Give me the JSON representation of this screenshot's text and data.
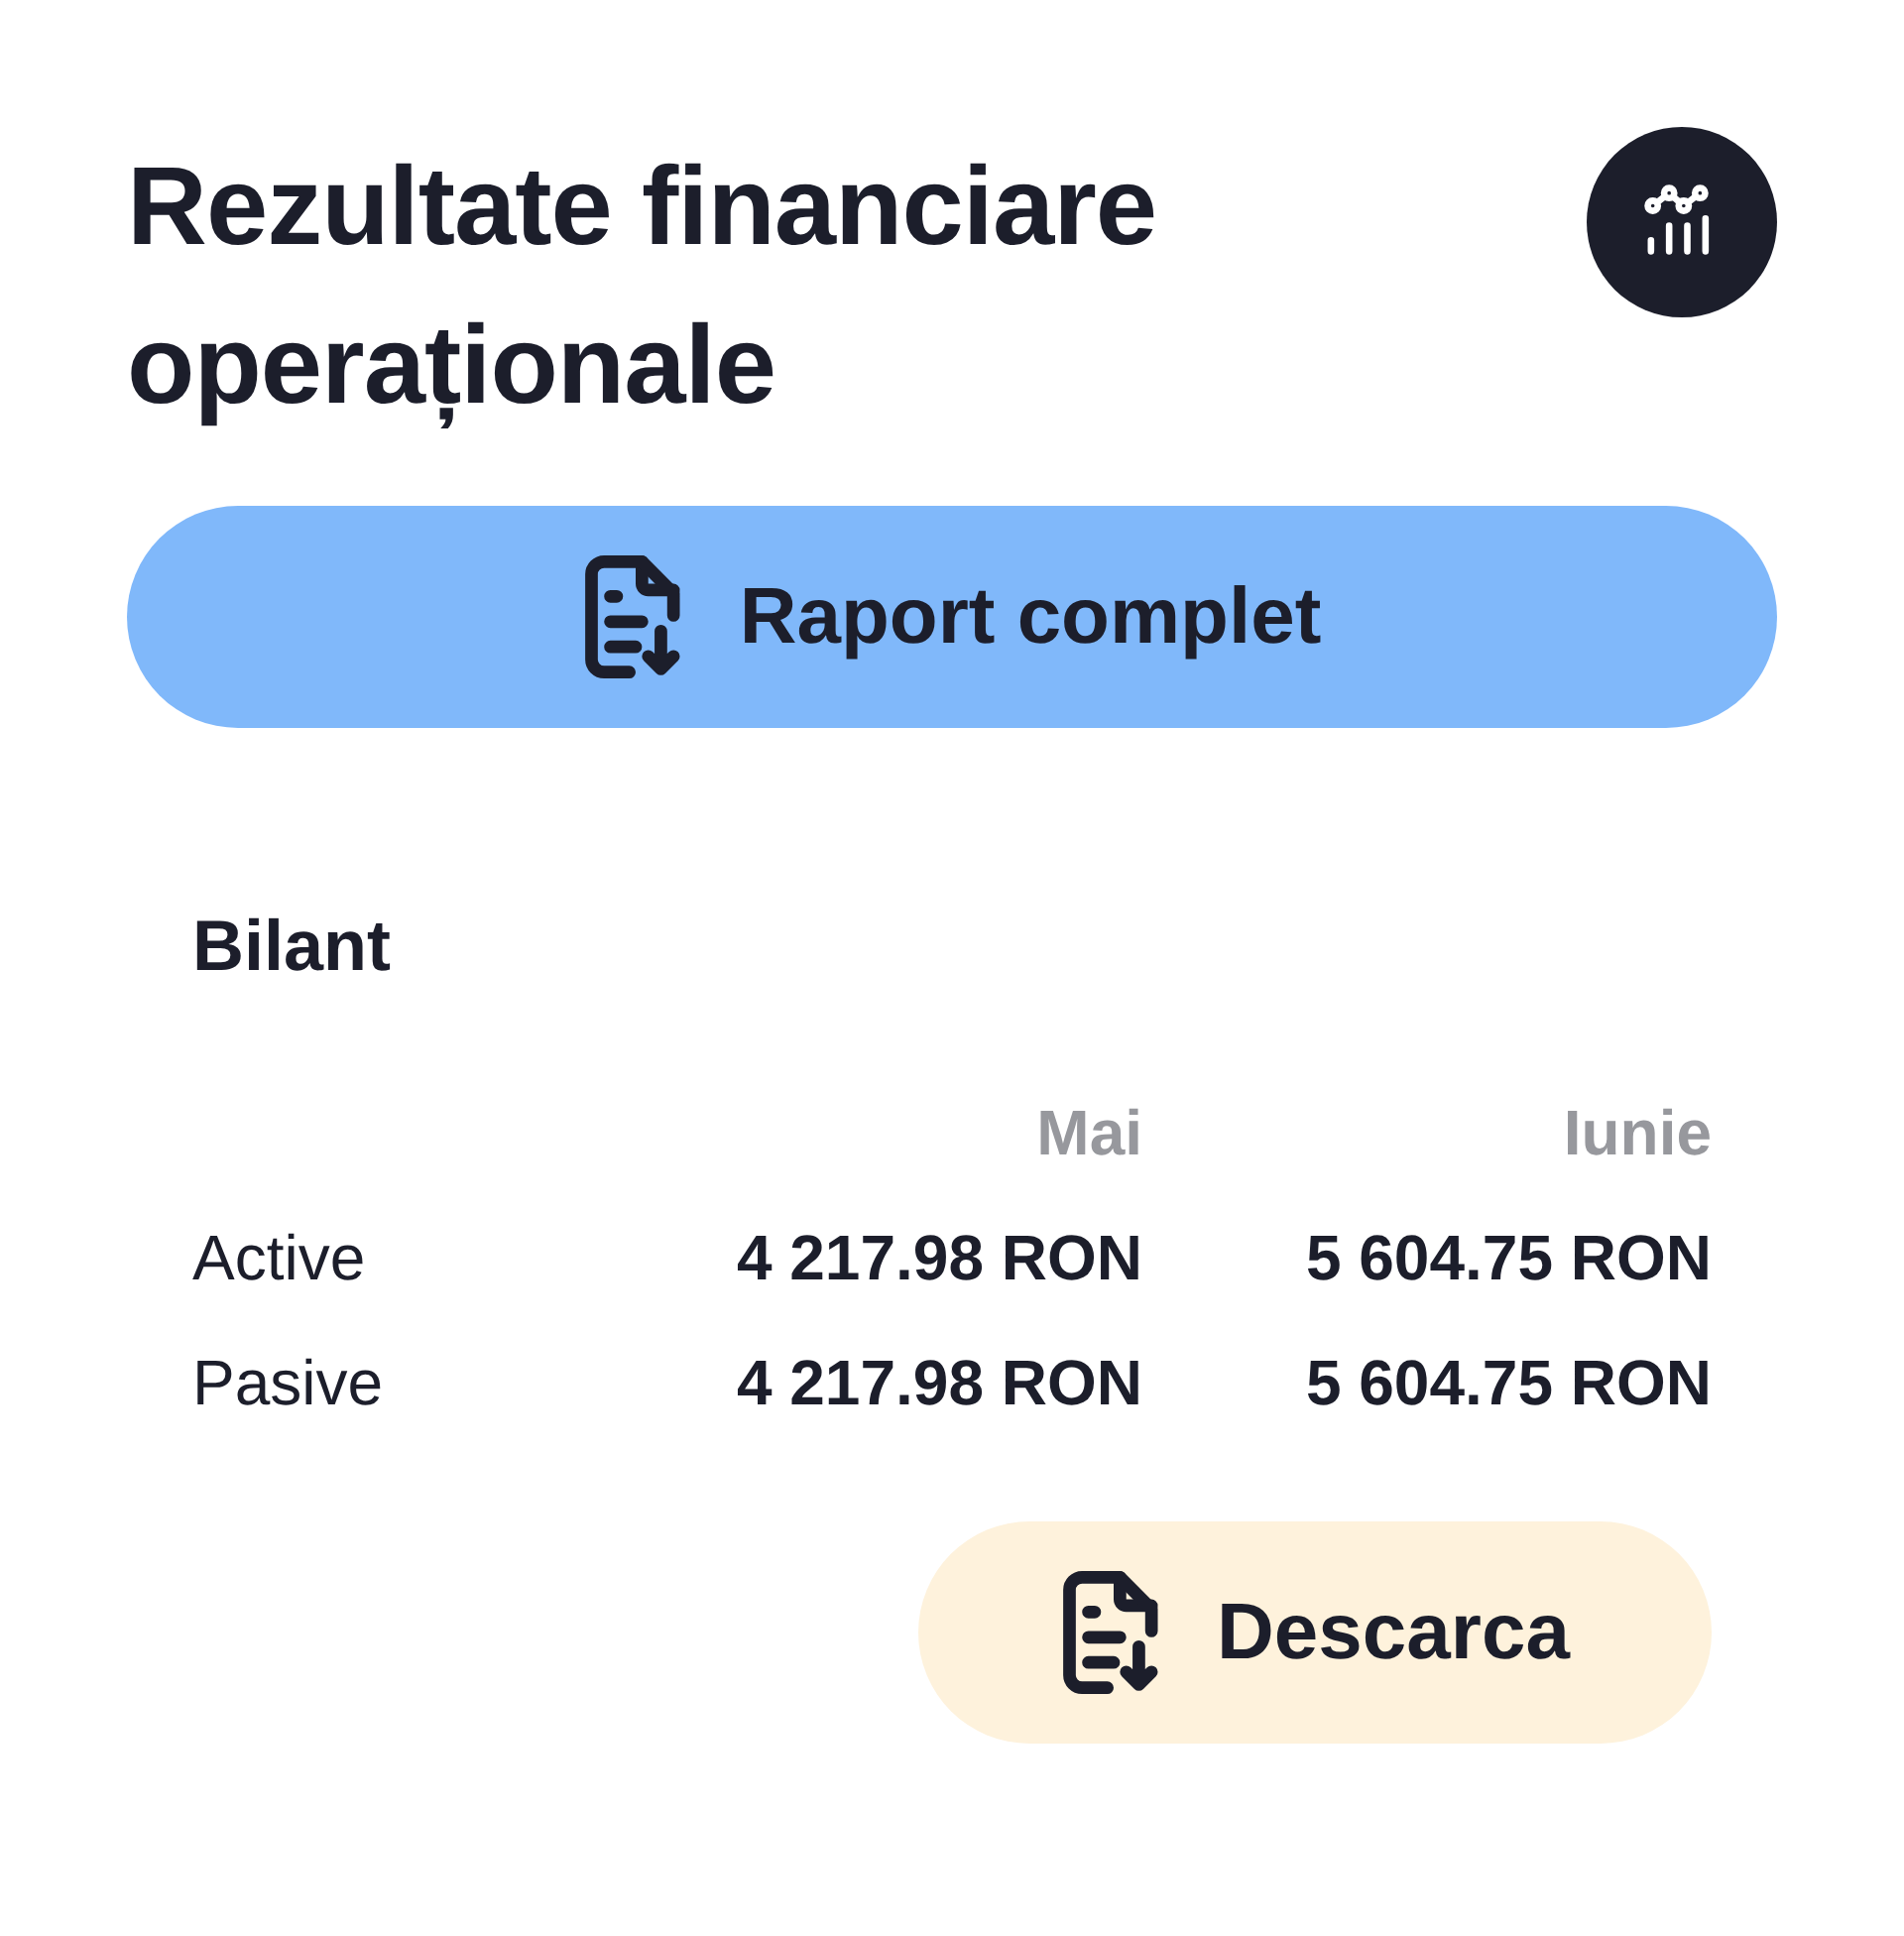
{
  "header": {
    "title": "Rezultate financiare operaționale"
  },
  "report_button": {
    "label": "Raport complet"
  },
  "balance": {
    "title": "Bilant",
    "columns": [
      "Mai",
      "Iunie"
    ],
    "rows": [
      {
        "label": "Active",
        "values": [
          "4 217.98 RON",
          "5 604.75 RON"
        ]
      },
      {
        "label": "Pasive",
        "values": [
          "4 217.98 RON",
          "5 604.75 RON"
        ]
      }
    ]
  },
  "download_button": {
    "label": "Descarca"
  }
}
